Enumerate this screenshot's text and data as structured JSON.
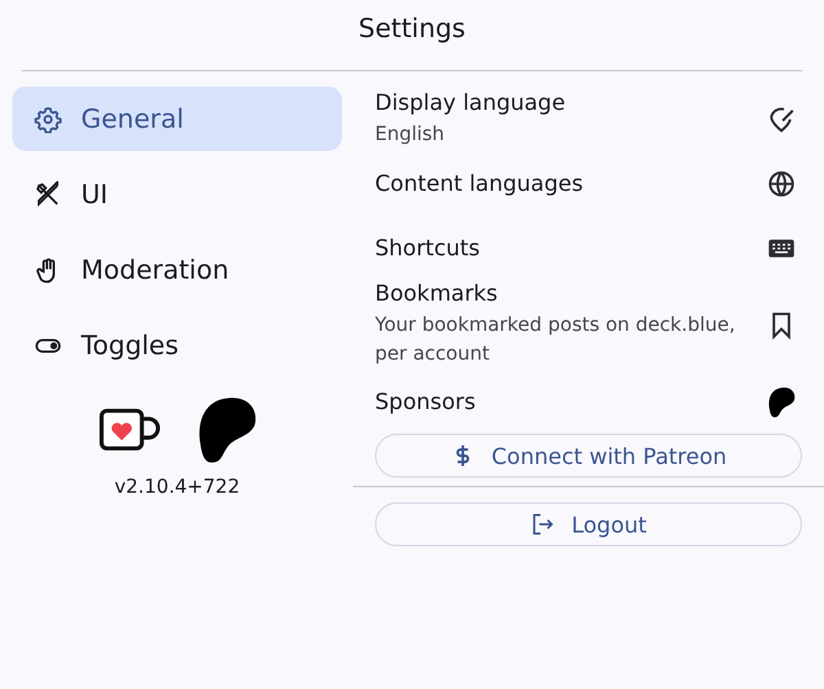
{
  "header": {
    "title": "Settings"
  },
  "nav": [
    {
      "label": "General",
      "selected": true
    },
    {
      "label": "UI",
      "selected": false
    },
    {
      "label": "Moderation",
      "selected": false
    },
    {
      "label": "Toggles",
      "selected": false
    }
  ],
  "version": "v2.10.4+722",
  "settings": [
    {
      "title": "Display language",
      "subtitle": "English"
    },
    {
      "title": "Content languages"
    },
    {
      "title": "Shortcuts"
    },
    {
      "title": "Bookmarks",
      "subtitle": "Your bookmarked posts on deck.blue, per account"
    },
    {
      "title": "Sponsors"
    }
  ],
  "patreon_button": "Connect with Patreon",
  "logout_button": "Logout"
}
